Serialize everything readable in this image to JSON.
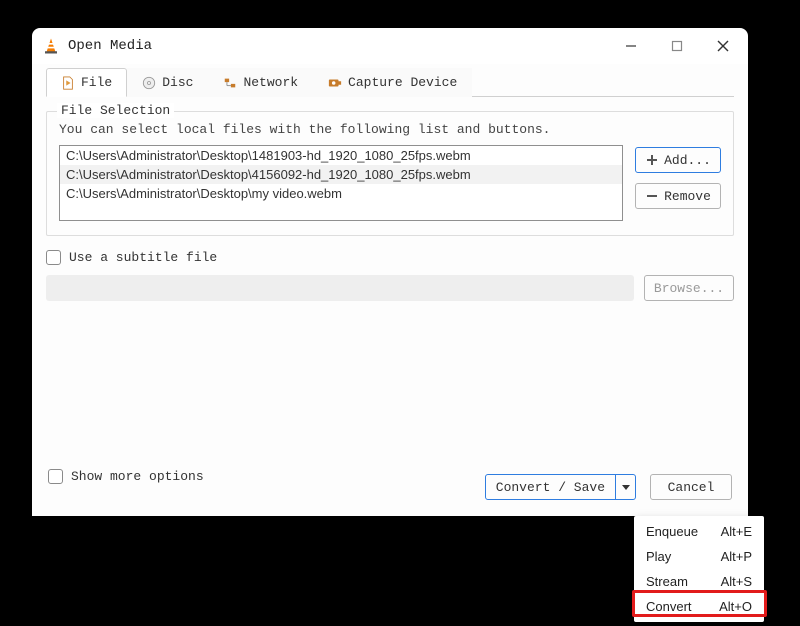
{
  "window": {
    "title": "Open Media"
  },
  "tabs": {
    "file": "File",
    "disc": "Disc",
    "network": "Network",
    "capture": "Capture Device"
  },
  "file_selection": {
    "legend": "File Selection",
    "helper": "You can select local files with the following list and buttons.",
    "files": [
      "C:\\Users\\Administrator\\Desktop\\1481903-hd_1920_1080_25fps.webm",
      "C:\\Users\\Administrator\\Desktop\\4156092-hd_1920_1080_25fps.webm",
      "C:\\Users\\Administrator\\Desktop\\my video.webm"
    ],
    "add_label": "Add...",
    "remove_label": "Remove"
  },
  "subtitle": {
    "checkbox_label": "Use a subtitle file",
    "browse_label": "Browse..."
  },
  "footer": {
    "show_more": "Show more options",
    "convert_save": "Convert / Save",
    "cancel": "Cancel"
  },
  "dropdown": {
    "items": [
      {
        "label": "Enqueue",
        "shortcut": "Alt+E"
      },
      {
        "label": "Play",
        "shortcut": "Alt+P"
      },
      {
        "label": "Stream",
        "shortcut": "Alt+S"
      },
      {
        "label": "Convert",
        "shortcut": "Alt+O"
      }
    ]
  }
}
